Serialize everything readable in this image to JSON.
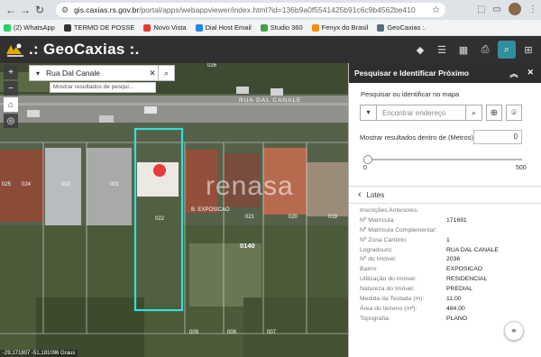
{
  "browser": {
    "url_host": "gis.caxias.rs.gov.br",
    "url_path": "/portal/apps/webappviewer/index.html?id=136b9a0f5541425b91c6c9b4562be410",
    "bookmarks": [
      {
        "label": "(2) WhatsApp",
        "color": "#25d366"
      },
      {
        "label": "TERMO DE POSSE",
        "color": "#333333"
      },
      {
        "label": "Novo Vista",
        "color": "#e53935"
      },
      {
        "label": "Dial Host Email",
        "color": "#1e88e5"
      },
      {
        "label": "Studio 360",
        "color": "#43a047"
      },
      {
        "label": "Fenyx do Brasil",
        "color": "#fb8c00"
      },
      {
        "label": "GeoCaxias :.",
        "color": "#546e7a"
      }
    ]
  },
  "app": {
    "title": ".: GeoCaxias :."
  },
  "map": {
    "search_value": "Rua Dal Canale",
    "search_suggestion": "Mostrar resultados de pesqui...",
    "street_label": "RUA DAL CANALE",
    "watermark": "renasa",
    "lot_labels": [
      "026",
      "025",
      "024",
      "002",
      "001",
      "022",
      "021",
      "020",
      "019",
      "0140",
      "009",
      "008",
      "007"
    ],
    "exposicao_label": "B. EXPOSICAO",
    "coords": "-29,171807 -51,181096 Graus"
  },
  "panel": {
    "title": "Pesquisar e Identificar Próximo",
    "subtitle": "Pesquisar ou identificar no mapa",
    "locate_placeholder": "Encontrar endereço",
    "distance_label": "Mostrar resultados dentro de (Metros)",
    "distance_value": "0",
    "slider_min": "0",
    "slider_max": "500",
    "slider_fraction": 0,
    "back_label": "Lotes",
    "attributes": [
      {
        "k": "Inscrições Anteriores:",
        "v": ""
      },
      {
        "k": "Nº Matrícula:",
        "v": "171691"
      },
      {
        "k": "Nº Matrícula Complementar:",
        "v": ""
      },
      {
        "k": "Nº Zona Cartório:",
        "v": "1"
      },
      {
        "k": "Logradouro:",
        "v": "RUA DAL CANALE"
      },
      {
        "k": "Nº do Imóvel:",
        "v": "2036"
      },
      {
        "k": "Bairro:",
        "v": "EXPOSICAO"
      },
      {
        "k": "Utilização do Imóvel:",
        "v": "RESIDENCIAL"
      },
      {
        "k": "Natureza do Imóvel:",
        "v": "PREDIAL"
      },
      {
        "k": "Medida da Testada (m):",
        "v": "11,00"
      },
      {
        "k": "Área do terreno (m²):",
        "v": "484,00"
      },
      {
        "k": "Topografia:",
        "v": "PLANO"
      }
    ]
  }
}
